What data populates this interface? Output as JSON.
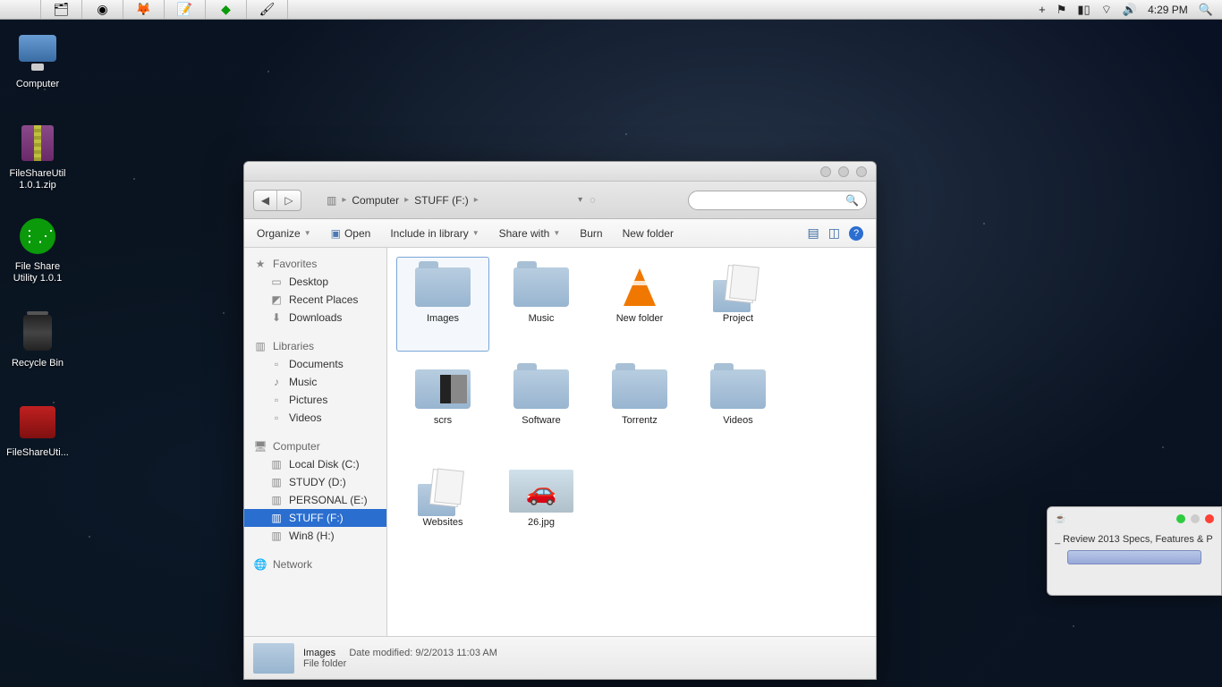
{
  "menubar": {
    "clock": "4:29 PM"
  },
  "desktop_icons": [
    {
      "label": "Computer",
      "kind": "monitor"
    },
    {
      "label": "FileShareUtil 1.0.1.zip",
      "kind": "archive"
    },
    {
      "label": "File Share Utility 1.0.1",
      "kind": "share-green"
    },
    {
      "label": "Recycle Bin",
      "kind": "bin"
    },
    {
      "label": "FileShareUti...",
      "kind": "share-red"
    }
  ],
  "finder": {
    "breadcrumb": {
      "root": "Computer",
      "current": "STUFF (F:)"
    },
    "commands": {
      "organize": "Organize",
      "open": "Open",
      "include": "Include in library",
      "share": "Share with",
      "burn": "Burn",
      "newfolder": "New folder"
    },
    "sidebar": {
      "favorites": {
        "header": "Favorites",
        "items": [
          "Desktop",
          "Recent Places",
          "Downloads"
        ]
      },
      "libraries": {
        "header": "Libraries",
        "items": [
          "Documents",
          "Music",
          "Pictures",
          "Videos"
        ]
      },
      "computer": {
        "header": "Computer",
        "items": [
          "Local Disk (C:)",
          "STUDY (D:)",
          "PERSONAL (E:)",
          "STUFF (F:)",
          "Win8 (H:)"
        ],
        "selected": "STUFF (F:)"
      },
      "network": {
        "header": "Network"
      }
    },
    "items": [
      {
        "name": "Images",
        "kind": "folder",
        "selected": true
      },
      {
        "name": "Music",
        "kind": "folder"
      },
      {
        "name": "New folder",
        "kind": "cone"
      },
      {
        "name": "Project",
        "kind": "sheets"
      },
      {
        "name": "scrs",
        "kind": "scrs"
      },
      {
        "name": "Software",
        "kind": "folder"
      },
      {
        "name": "Torrentz",
        "kind": "folder"
      },
      {
        "name": "Videos",
        "kind": "folder"
      },
      {
        "name": "Websites",
        "kind": "sheets"
      },
      {
        "name": "26.jpg",
        "kind": "image"
      }
    ],
    "status": {
      "name": "Images",
      "type": "File folder",
      "modified_label": "Date modified:",
      "modified_value": "9/2/2013 11:03 AM"
    }
  },
  "toast": {
    "text": "_ Review 2013 Specs, Features & P"
  }
}
